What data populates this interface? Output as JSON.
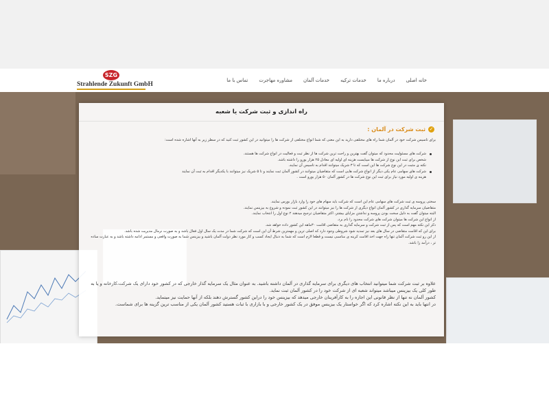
{
  "logo": {
    "badge": "SZG",
    "name": "Strahlende Zukunft GmbH"
  },
  "menu": [
    "خانه اصلی",
    "درباره ما",
    "خدمات ترکیه",
    "خدمات آلمان",
    "مشاوره مهاجرت",
    "تماس با ما"
  ],
  "card": {
    "title": "راه اندازی و ثبت شرکت یا شعبه",
    "section_heading": "ثبت شرکت در آلمان :",
    "intro": "برای تاسیس شرکت خود در آلمان شما راه های مختلفی دارید به این معنی که شما انواع مختلفی از شرکت ها را میتوانید در این کشور ثبت کنید که در سطر زیر به آنها اشاره شده است:",
    "bullets": [
      "شرکت های مسئولیت محدود که میتوان گفت بهترین و راحت ترین شرکت ها از نظر ثبت و فعالیت در انواع شرکت ها هستند.",
      "شخص برای ثبت این نوع از شرکت ها میبایست هزینه ای اولیه ای معادل ۲۵ هزار یورو را داشته باشد.",
      "نکته ی مثبت در این نوع شرکت ها این است که تا ۳ شریک میتوانند اقدام به تاسیس آن نمایند.",
      "شرکت های سهامی عام یکی دیگر از انواع شرکت هایی است که متقاضیان میتوانند در کشور آلمان ثبت نمایند و تا ۵ شریک نیز میتوانند با یکدیگر اقدام به ثبت آن نمایند",
      "هزینه ی اولیه مورد نیاز برای ثبت این نوع شرکت ها در کشور آلمان ۵۰ هزار یورو است ."
    ],
    "paragraphs": [
      "سختی پروسه ی ثبت شرکت های سهامی عام این است که شرکت باید سهام های خود را وارد بازار بورس نمایند.",
      "متقاضیان سرمایه گذاری در کشور آلمان انواع دیگری از شرکت ها را نیز میتوانند در این کشور ثبت نموده و شروع به بیزینس نمایند.",
      "البته میتوان گفت به دلیل سخت بودن پروسه و نداشتن مزایای بیشتر، اکثر متقاضیان ترجیح میدهند ۲ نوع اول را انتخاب نمایند.",
      "از انواع این شرکت ها میتوان شرکت های شرکت محدود را نام برد.",
      "ذکر این نکته مهم است که پس از ثبت شرکت و سرمایه گذاری به متقاضی اقامت ۳۰ماهه این کشور داده خواهد شد.",
      "برای این که اقامت متقاضی در سال های بعد نیز تمدید شود شروطی وجود دارد که اصلی ترین و مهمترین شرط آن این است که شرکت شما در مدت یک سال اول فعال باشد و به صورت نرمال مدیریت شده باشد.",
      "از این رو ثبت شرکت آلمان تنها راه جهت اخذ اقامت کرینه ی مناسبی نیست و قطعا لازم است که شما به دنبال ایجاد کسب و کار مورد نظر دولت آلمان باشید و بیزینس شما به صورت واقعی و مستمر ادامه داشته باشد و به عبارت ساده تر ، درآمد زا باشد."
    ],
    "closing": [
      "علاوه بر ثبت شرکت شما میتوانید انتخاب های دیگری برای سرمایه گذاری در آلمان داشته باشید. به عنوان مثال یک سرمایه گذار خارجی که در کشور خود دارای یک شرکت،کارخانه و یا به طور کلی یک بیزینس میباشد میتواند شعبه ای از شرکت خود را در کشور آلمان ثبت نماید.",
      "کشور آلمان نه تنها از نظر قانونی این اجازه را به کارآفرینان خارجی میدهد که بیزینس خود را دراین کشور گسترش دهند بلکه از آنها حمایت نیز میتماید.",
      "در انتها باید به این نکته اشاره کرد که اگر خواستار یک بیزینس موفق در یک کشور خارجی و با بازاری با ثبات هستید کشور آلمان یکی از مناسب ترین گزینه ها برای شماست."
    ]
  }
}
